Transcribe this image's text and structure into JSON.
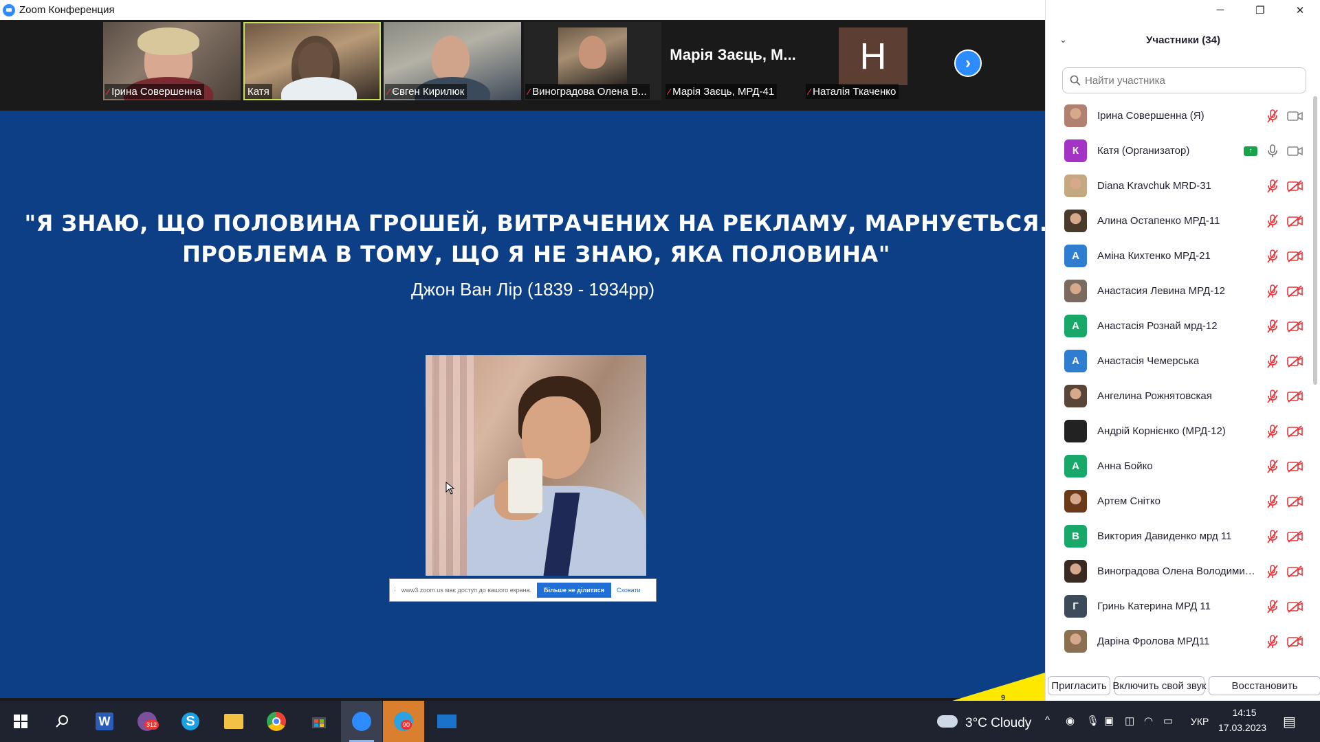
{
  "window": {
    "title": "Zoom Конференция"
  },
  "gallery": {
    "tiles": [
      {
        "name": "Ірина Совершенна",
        "muted": true
      },
      {
        "name": "Катя",
        "muted": false,
        "active": true
      },
      {
        "name": "Євген Кирилюк",
        "muted": true
      },
      {
        "name": "Виноградова Олена В...",
        "muted": true
      },
      {
        "name": "Марія Заєць, МРД-41",
        "muted": true,
        "display_text": "Марія Заєць, М..."
      },
      {
        "name": "Наталія Ткаченко",
        "muted": true,
        "letter": "H"
      }
    ],
    "next_label": "›"
  },
  "slide": {
    "quote_line1": "\"Я ЗНАЮ, ЩО ПОЛОВИНА ГРОШЕЙ, ВИТРАЧЕНИХ НА РЕКЛАМУ, МАРНУЄТЬСЯ.",
    "quote_line2": "ПРОБЛЕМА В ТОМУ, ЩО Я НЕ ЗНАЮ, ЯКА ПОЛОВИНА\"",
    "author": "Джон Ван Лір (1839 - 1934рр)",
    "page_number": "9"
  },
  "share_bar": {
    "text": "www3.zoom.us має доступ до вашого екрана.",
    "stop_label": "Більше не ділитися",
    "hide_label": "Сховати"
  },
  "panel": {
    "title": "Участники (34)",
    "search_placeholder": "Найти участника",
    "participants": [
      {
        "name": "Ірина Совершенна (Я)",
        "avatar_type": "photo",
        "color": "#b08070",
        "mic": "muted",
        "cam": "on"
      },
      {
        "name": "Катя (Организатор)",
        "avatar_type": "letter",
        "letter": "К",
        "color": "#a432c4",
        "mic": "on",
        "cam": "on",
        "sharing": true
      },
      {
        "name": "Diana Kravchuk MRD-31",
        "avatar_type": "photo",
        "color": "#c4a882",
        "mic": "muted",
        "cam": "off"
      },
      {
        "name": "Алина Остапенко МРД-11",
        "avatar_type": "photo",
        "color": "#4a3a2a",
        "mic": "muted",
        "cam": "off"
      },
      {
        "name": "Аміна Кихтенко МРД-21",
        "avatar_type": "letter",
        "letter": "A",
        "color": "#2f7dd1",
        "mic": "muted",
        "cam": "off"
      },
      {
        "name": "Анастасия Левина МРД-12",
        "avatar_type": "photo",
        "color": "#7a6a60",
        "mic": "muted",
        "cam": "off"
      },
      {
        "name": "Анастасія Рознай мрд-12",
        "avatar_type": "letter",
        "letter": "A",
        "color": "#18a86a",
        "mic": "muted",
        "cam": "off"
      },
      {
        "name": "Анастасія Чемерська",
        "avatar_type": "letter",
        "letter": "A",
        "color": "#2f7dd1",
        "mic": "muted",
        "cam": "off"
      },
      {
        "name": "Ангелина Рожнятовская",
        "avatar_type": "photo",
        "color": "#5a4638",
        "mic": "muted",
        "cam": "off"
      },
      {
        "name": "Андрій Корнієнко (МРД-12)",
        "avatar_type": "blank",
        "color": "#222222",
        "mic": "muted",
        "cam": "off"
      },
      {
        "name": "Анна Бойко",
        "avatar_type": "letter",
        "letter": "A",
        "color": "#18a86a",
        "mic": "muted",
        "cam": "off"
      },
      {
        "name": "Артем Снітко",
        "avatar_type": "photo",
        "color": "#6a3a1a",
        "mic": "muted",
        "cam": "off"
      },
      {
        "name": "Виктория Давиденко мрд 11",
        "avatar_type": "letter",
        "letter": "B",
        "color": "#18a86a",
        "mic": "muted",
        "cam": "off"
      },
      {
        "name": "Виноградова Олена Володимир...",
        "avatar_type": "photo",
        "color": "#3a2a22",
        "mic": "muted",
        "cam": "off"
      },
      {
        "name": "Гринь Катерина МРД 11",
        "avatar_type": "letter",
        "letter": "Г",
        "color": "#3c4a5a",
        "mic": "muted",
        "cam": "off"
      },
      {
        "name": "Даріна Фролова МРД11",
        "avatar_type": "photo",
        "color": "#8a7050",
        "mic": "muted",
        "cam": "off"
      }
    ],
    "buttons": {
      "invite": "Пригласить",
      "unmute": "Включить свой звук",
      "restore": "Восстановить"
    }
  },
  "taskbar": {
    "weather": "3°C  Cloudy",
    "lang": "УКР",
    "time": "14:15",
    "date": "17.03.2023",
    "viber_badge": "312",
    "telegram_badge": "90"
  }
}
